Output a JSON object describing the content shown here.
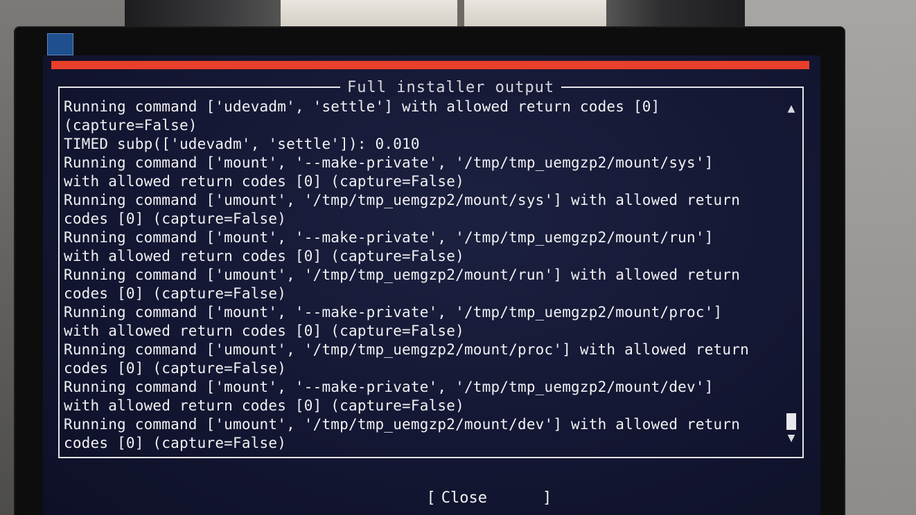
{
  "dialog": {
    "title": "Full installer output",
    "lines": [
      "Running command ['udevadm', 'settle'] with allowed return codes [0]",
      "(capture=False)",
      "TIMED subp(['udevadm', 'settle']): 0.010",
      "Running command ['mount', '--make-private', '/tmp/tmp_uemgzp2/mount/sys']",
      "with allowed return codes [0] (capture=False)",
      "Running command ['umount', '/tmp/tmp_uemgzp2/mount/sys'] with allowed return",
      "codes [0] (capture=False)",
      "Running command ['mount', '--make-private', '/tmp/tmp_uemgzp2/mount/run']",
      "with allowed return codes [0] (capture=False)",
      "Running command ['umount', '/tmp/tmp_uemgzp2/mount/run'] with allowed return",
      "codes [0] (capture=False)",
      "Running command ['mount', '--make-private', '/tmp/tmp_uemgzp2/mount/proc']",
      "with allowed return codes [0] (capture=False)",
      "Running command ['umount', '/tmp/tmp_uemgzp2/mount/proc'] with allowed return",
      "codes [0] (capture=False)",
      "Running command ['mount', '--make-private', '/tmp/tmp_uemgzp2/mount/dev']",
      "with allowed return codes [0] (capture=False)",
      "Running command ['umount', '/tmp/tmp_uemgzp2/mount/dev'] with allowed return",
      "codes [0] (capture=False)"
    ]
  },
  "scrollbar": {
    "up_icon": "▲",
    "down_icon": "▼"
  },
  "close_button": {
    "open_bracket": "[",
    "label": "Close",
    "close_bracket": "]"
  },
  "colors": {
    "header_bar": "#e8402a",
    "screen_background": "#141733",
    "text": "#f1f1f3"
  }
}
